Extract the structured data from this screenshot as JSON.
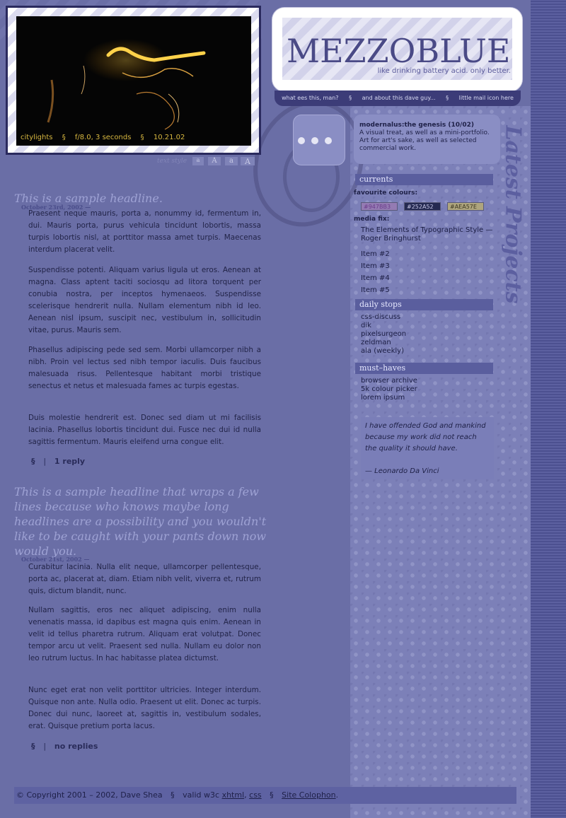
{
  "photo": {
    "caption": [
      "citylights",
      "§",
      "f/8.0, 3 seconds",
      "§",
      "10.21.02"
    ]
  },
  "text_style": {
    "label": "text style",
    "buttons": [
      "a",
      "A",
      "a",
      "A"
    ]
  },
  "logo": {
    "title": "MEZZOBLUE",
    "tagline": "like drinking battery acid. only better."
  },
  "nav": {
    "items": [
      "what ees this, man?",
      "§",
      "and about this dave guy...",
      "§",
      "little mail icon here"
    ]
  },
  "projects": {
    "heading": "Latest Projects",
    "title": "modernalus:the genesis (10/02)",
    "description": "A visual treat, as well as a mini-portfolio. Art for art's sake, as well as selected commercial work."
  },
  "sidebar": {
    "currents_heading": "currents",
    "favourite_label": "favourite colours:",
    "colours": [
      {
        "hex": "#947BB3",
        "color": "#947BB3",
        "text": "#6a3a8a"
      },
      {
        "hex": "#252A52",
        "color": "#252A52",
        "text": "#c8c8e8"
      },
      {
        "hex": "#AEA57E",
        "color": "#AEA57E",
        "text": "#3a3420"
      }
    ],
    "media_label": "media fix:",
    "media": [
      "The Elements of Typographic Style — Roger Bringhurst",
      "Item #2",
      "Item #3",
      "Item #4",
      "Item #5"
    ],
    "daily_heading": "daily stops",
    "daily": [
      "css-discuss",
      "dik",
      "pixelsurgeon",
      "zeldman",
      "ala (weekly)"
    ],
    "must_heading": "must–haves",
    "must": [
      "browser archive",
      "5k colour picker",
      "lorem ipsum"
    ],
    "quote": "I have offended God and mankind because my work did not reach the quality it should have.",
    "quote_author": "— Leonardo Da Vinci"
  },
  "posts": [
    {
      "headline": "This is a sample headline.",
      "date": "October 23rd, 2002 —",
      "paragraphs": [
        "Praesent neque mauris, porta a, nonummy id, fermentum in, dui. Mauris porta, purus vehicula tincidunt lobortis, massa turpis lobortis nisl, at porttitor massa amet turpis. Maecenas interdum placerat velit.",
        "Suspendisse potenti. Aliquam varius ligula ut eros. Aenean at magna. Class aptent taciti sociosqu ad litora torquent per conubia nostra, per inceptos hymenaeos. Suspendisse scelerisque hendrerit nulla. Nullam elementum nibh id leo. Aenean nisl ipsum, suscipit nec, vestibulum in, sollicitudin vitae, purus. Mauris sem.",
        "Phasellus adipiscing pede sed sem. Morbi ullamcorper nibh a nibh. Proin vel lectus sed nibh tempor iaculis. Duis faucibus malesuada risus. Pellentesque habitant morbi tristique senectus et netus et malesuada fames ac turpis egestas.",
        "Duis molestie hendrerit est. Donec sed diam ut mi facilisis lacinia. Phasellus lobortis tincidunt dui. Fusce nec dui id nulla sagittis fermentum. Mauris eleifend urna congue elit."
      ],
      "foot_symbol": "§",
      "foot_sep": "|",
      "foot_link": "1 reply"
    },
    {
      "headline": "This is a sample headline that wraps a few lines because who knows maybe long headlines are a possibility and you wouldn't like to be caught with your pants down now would you.",
      "date": "October 21st, 2002 —",
      "paragraphs": [
        "Curabitur lacinia. Nulla elit neque, ullamcorper pellentesque, porta ac, placerat at, diam. Etiam nibh velit, viverra et, rutrum quis, dictum blandit, nunc.",
        "Nullam sagittis, eros nec aliquet adipiscing, enim nulla venenatis massa, id dapibus est magna quis enim. Aenean in velit id tellus pharetra rutrum. Aliquam erat volutpat. Donec tempor arcu ut velit. Praesent sed nulla. Nullam eu dolor non leo rutrum luctus. In hac habitasse platea dictumst.",
        "Nunc eget erat non velit porttitor ultricies. Integer interdum. Quisque non ante. Nulla odio. Praesent ut elit. Donec ac turpis. Donec dui nunc, laoreet at, sagittis in, vestibulum sodales, erat. Quisque pretium porta lacus."
      ],
      "foot_symbol": "§",
      "foot_sep": "|",
      "foot_link": "no replies"
    }
  ],
  "footer": {
    "copyright": "© Copyright 2001 – 2002, Dave Shea",
    "sep": "§",
    "valid": "valid w3c",
    "xhtml": "xhtml",
    "comma": ",",
    "css": "css",
    "colophon": "Site Colophon",
    "period": "."
  }
}
